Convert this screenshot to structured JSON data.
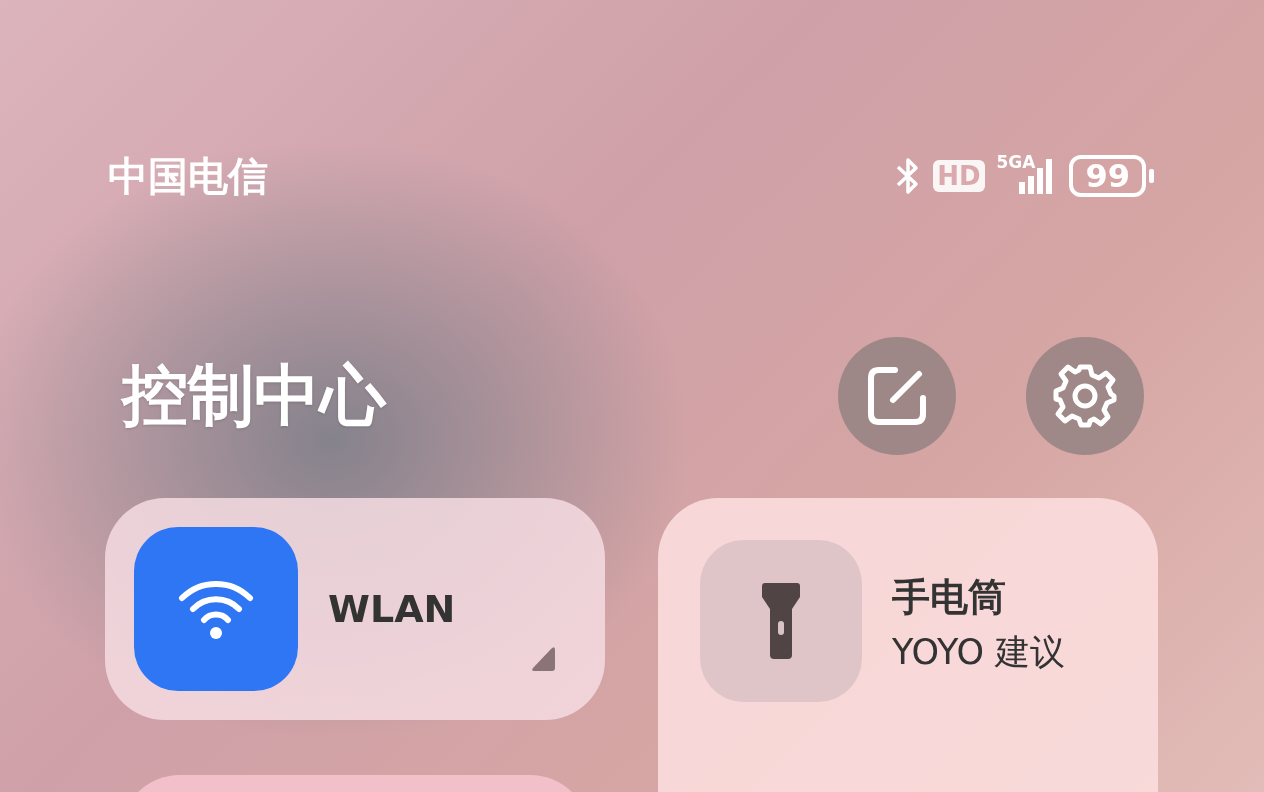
{
  "status_bar": {
    "carrier": "中国电信",
    "hd_badge": "HD",
    "network_type": "5GA",
    "battery": "99"
  },
  "header": {
    "title": "控制中心"
  },
  "tiles": [
    {
      "kind": "wifi",
      "label": "WLAN",
      "on": true
    },
    {
      "kind": "flashlight",
      "label": "手电筒",
      "subtitle": "YOYO 建议",
      "on": false
    }
  ]
}
